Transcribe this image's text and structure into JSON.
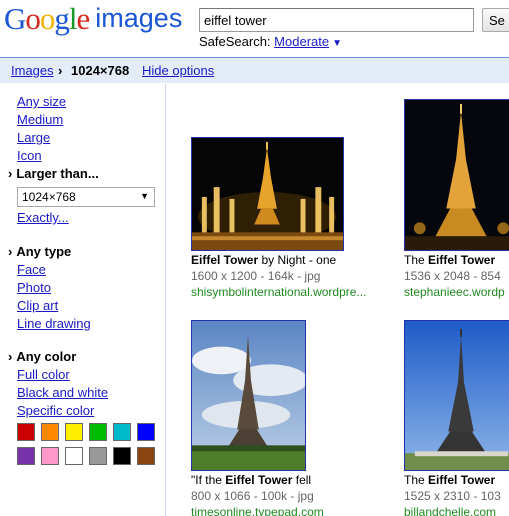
{
  "header": {
    "logo": {
      "letters": [
        "G",
        "o",
        "o",
        "g",
        "l",
        "e"
      ],
      "word": "images"
    },
    "search_value": "eiffel tower",
    "search_button": "Se",
    "safesearch_label": "SafeSearch:",
    "safesearch_value": "Moderate"
  },
  "breadcrumb": {
    "images": "Images",
    "separator": "›",
    "size": "1024×768",
    "hide_options": "Hide options"
  },
  "sidebar": {
    "size_options": [
      "Any size",
      "Medium",
      "Large",
      "Icon"
    ],
    "larger_than": "Larger than...",
    "larger_than_value": "1024×768",
    "exactly": "Exactly...",
    "type_selected": "Any type",
    "type_options": [
      "Face",
      "Photo",
      "Clip art",
      "Line drawing"
    ],
    "color_selected": "Any color",
    "color_options": [
      "Full color",
      "Black and white",
      "Specific color"
    ],
    "swatches": [
      "#cc0000",
      "#ff8800",
      "#ffee00",
      "#00bb00",
      "#00bbcc",
      "#0000ff",
      "#7733aa",
      "#ff99cc",
      "#ffffff",
      "#999999",
      "#000000",
      "#8b4513"
    ]
  },
  "results": [
    {
      "title_bold": "Eiffel Tower",
      "title_rest": " by Night - one",
      "meta": "1600 x 1200 - 164k - jpg",
      "site": "shisymbolinternational.wordpre..."
    },
    {
      "title_pre": "The ",
      "title_bold": "Eiffel Tower",
      "meta": "1536 x 2048 - 854",
      "site": "stephanieec.wordp"
    },
    {
      "title_pre": "\"If the ",
      "title_bold": "Eiffel Tower",
      "title_rest": " fell",
      "meta": "800 x 1066 - 100k - jpg",
      "site": "timesonline.typepad.com"
    },
    {
      "title_pre": "The ",
      "title_bold": "Eiffel Tower",
      "meta": "1525 x 2310 - 103",
      "site": "billandchelle.com"
    }
  ]
}
